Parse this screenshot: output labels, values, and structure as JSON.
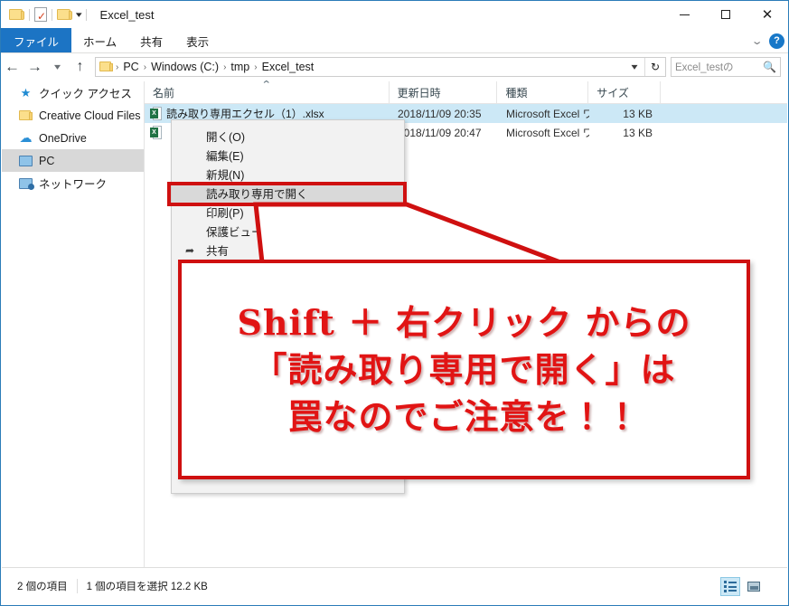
{
  "window": {
    "title": "Excel_test",
    "quick_access": [
      {
        "name": "folder-icon",
        "label": "folder"
      },
      {
        "name": "properties-icon",
        "label": "properties"
      },
      {
        "name": "new-folder-icon",
        "label": "new folder"
      }
    ],
    "controls": {
      "minimize": "─",
      "maximize": "□",
      "close": "✕"
    }
  },
  "ribbon": {
    "tabs": [
      {
        "label": "ファイル",
        "active": true
      },
      {
        "label": "ホーム",
        "active": false
      },
      {
        "label": "共有",
        "active": false
      },
      {
        "label": "表示",
        "active": false
      }
    ],
    "expand_icon": "⌄",
    "help_label": "?"
  },
  "address": {
    "back_icon": "←",
    "forward_icon": "→",
    "recent_icon": "⌄",
    "up_icon": "↑",
    "breadcrumb": [
      "PC",
      "Windows (C:)",
      "tmp",
      "Excel_test"
    ],
    "separator": "›",
    "dropdown_icon": "⌄",
    "refresh_icon": "↻"
  },
  "search": {
    "placeholder": "Excel_testの",
    "icon": "⌕"
  },
  "sidebar": {
    "items": [
      {
        "label": "クイック アクセス",
        "icon": "star-icon",
        "selected": false
      },
      {
        "label": "Creative Cloud Files",
        "icon": "folder-icon",
        "selected": false
      },
      {
        "label": "OneDrive",
        "icon": "cloud-icon",
        "selected": false
      },
      {
        "label": "PC",
        "icon": "monitor-icon",
        "selected": true
      },
      {
        "label": "ネットワーク",
        "icon": "network-icon",
        "selected": false
      }
    ]
  },
  "file_list": {
    "columns": [
      {
        "label": "名前",
        "sorted": true,
        "sort_icon": "⌃"
      },
      {
        "label": "更新日時"
      },
      {
        "label": "種類"
      },
      {
        "label": "サイズ"
      }
    ],
    "rows": [
      {
        "name": "読み取り専用エクセル（1）.xlsx",
        "date": "2018/11/09 20:35",
        "type": "Microsoft Excel ワ...",
        "size": "13 KB",
        "selected": true
      },
      {
        "name": "",
        "date": "2018/11/09 20:47",
        "type": "Microsoft Excel ワ...",
        "size": "13 KB",
        "selected": false
      }
    ]
  },
  "context_menu": {
    "items": [
      {
        "label": "開く(O)",
        "accel": "O",
        "icon": "",
        "highlighted": false
      },
      {
        "label": "編集(E)",
        "accel": "E",
        "icon": "",
        "highlighted": false
      },
      {
        "label": "新規(N)",
        "accel": "N",
        "icon": "",
        "highlighted": false
      },
      {
        "label": "読み取り専用で開く",
        "accel": "",
        "icon": "",
        "highlighted": true
      },
      {
        "label": "印刷(P)",
        "accel": "P",
        "icon": "",
        "highlighted": false
      },
      {
        "label": "保護ビューで開く",
        "accel": "",
        "icon": "",
        "highlighted": false
      },
      {
        "label": "共有",
        "accel": "",
        "icon": "share-icon",
        "highlighted": false
      }
    ]
  },
  "annotation": {
    "lines": [
      "Shift ＋ 右クリック からの",
      "「読み取り専用で開く」は",
      "罠なのでご注意を！！"
    ],
    "color": "#e11414",
    "border_color": "#cf1010"
  },
  "status_bar": {
    "item_count": "2 個の項目",
    "selection": "1 個の項目を選択  12.2 KB",
    "views": [
      {
        "name": "details-view-button",
        "active": true
      },
      {
        "name": "large-icons-view-button",
        "active": false
      }
    ]
  }
}
